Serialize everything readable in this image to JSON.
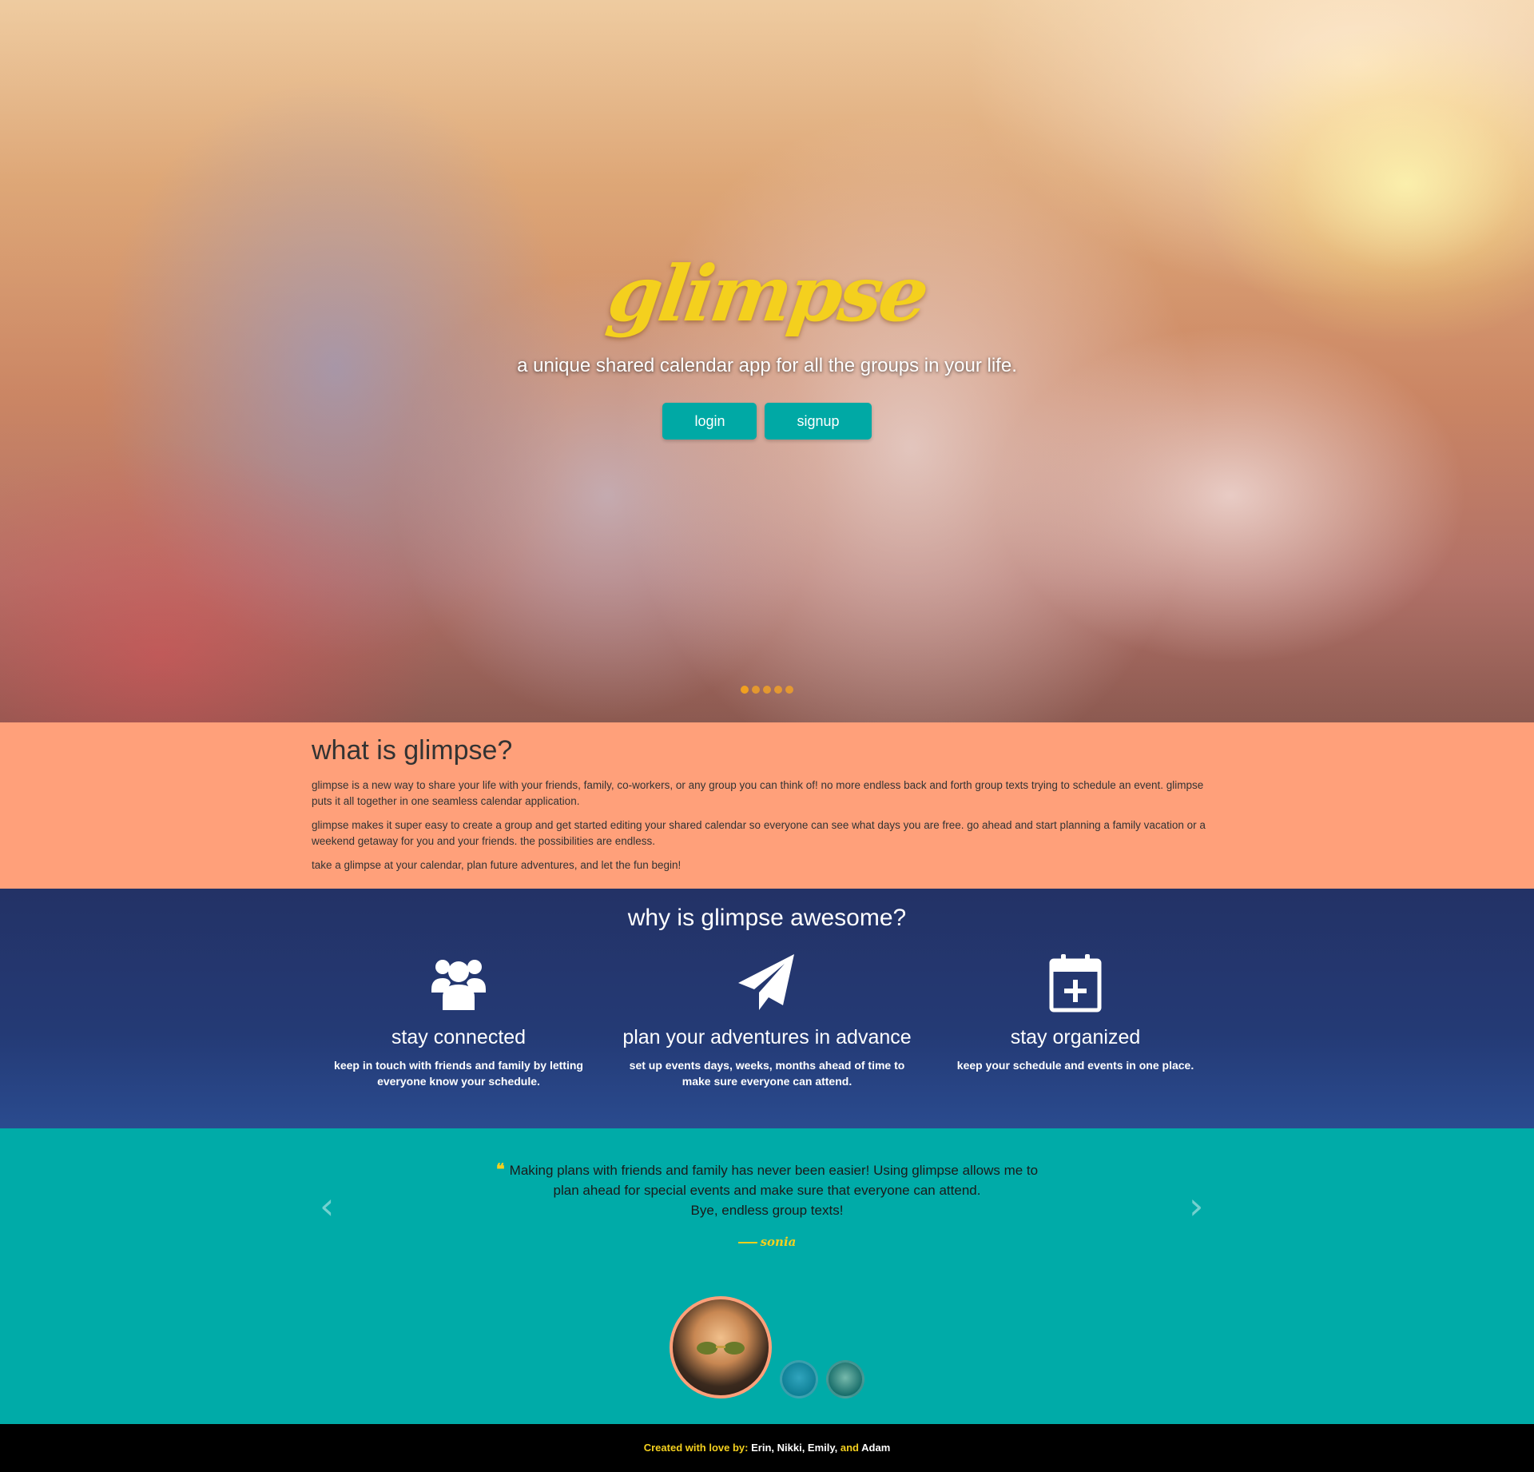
{
  "hero": {
    "logo": "glimpse",
    "tagline": "a unique shared calendar app for all the groups in your life.",
    "login_label": "login",
    "signup_label": "signup",
    "carousel_dots": 5,
    "carousel_active_index": 0
  },
  "what": {
    "title": "what is glimpse?",
    "paragraphs": [
      "glimpse is a new way to share your life with your friends, family, co-workers, or any group you can think of! no more endless back and forth group texts trying to schedule an event. glimpse puts it all together in one seamless calendar application.",
      "glimpse makes it super easy to create a group and get started editing your shared calendar so everyone can see what days you are free. go ahead and start planning a family vacation or a weekend getaway for you and your friends. the possibilities are endless.",
      "take a glimpse at your calendar, plan future adventures, and let the fun begin!"
    ]
  },
  "why": {
    "title": "why is glimpse awesome?",
    "features": [
      {
        "icon": "users-icon",
        "title": "stay connected",
        "text": "keep in touch with friends and family by letting everyone know your schedule."
      },
      {
        "icon": "paper-plane-icon",
        "title": "plan your adventures in advance",
        "text": "set up events days, weeks, months ahead of time to make sure everyone can attend."
      },
      {
        "icon": "calendar-plus-icon",
        "title": "stay organized",
        "text": "keep your schedule and events in one place."
      }
    ]
  },
  "testimonial": {
    "quote_lines": [
      "Making plans with friends and family has never been easier! Using glimpse allows me to",
      "plan ahead for special events and make sure that everyone can attend.",
      "Bye, endless group texts!"
    ],
    "author": "sonia"
  },
  "footer": {
    "prefix": "Created with love by:",
    "names1": "Erin, Nikki, Emily,",
    "and": "and",
    "names2": "Adam"
  },
  "colors": {
    "accent_teal": "#00a9a5",
    "brand_yellow": "#f4d01e",
    "salmon": "#ffa07a",
    "navy": "#233266"
  }
}
